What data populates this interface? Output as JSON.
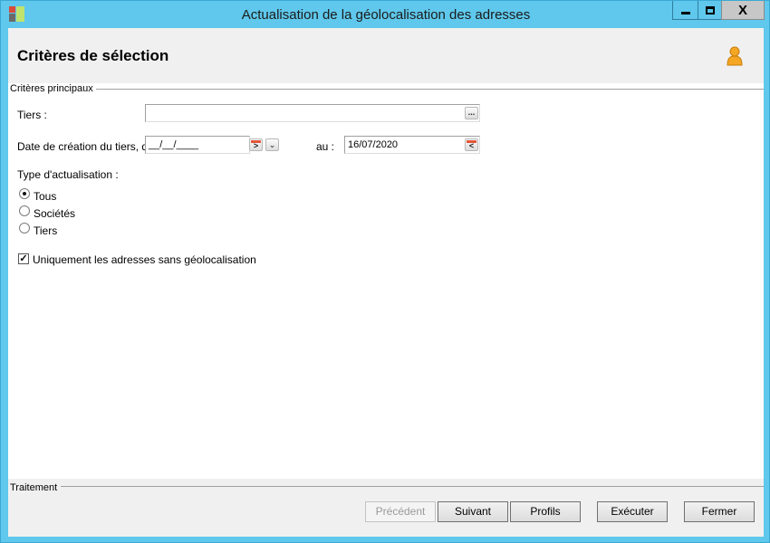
{
  "window": {
    "title": "Actualisation de la géolocalisation des adresses",
    "close_label": "X"
  },
  "header": {
    "title": "Critères de sélection",
    "user_icon": "user-icon"
  },
  "criteria": {
    "group_label": "Critères principaux",
    "tiers": {
      "label": "Tiers :",
      "value": "",
      "browse_label": "..."
    },
    "date": {
      "label": "Date de création du tiers, du :",
      "from_value": "__/__/____",
      "to_label": "au :",
      "to_value": "16/07/2020"
    },
    "type": {
      "label": "Type d'actualisation :",
      "options": [
        {
          "label": "Tous",
          "checked": true
        },
        {
          "label": "Sociétés",
          "checked": false
        },
        {
          "label": "Tiers",
          "checked": false
        }
      ]
    },
    "only_without_geo": {
      "label": "Uniquement les adresses sans géolocalisation",
      "checked": true
    }
  },
  "footer": {
    "group_label": "Traitement",
    "buttons": {
      "previous": "Précédent",
      "next": "Suivant",
      "profiles": "Profils",
      "execute": "Exécuter",
      "close": "Fermer"
    }
  },
  "colors": {
    "titlebar": "#5fc8ec",
    "header_bg": "#f0f0f0",
    "calendar_accent": "#e2573b",
    "user_icon": "#f5a623"
  }
}
